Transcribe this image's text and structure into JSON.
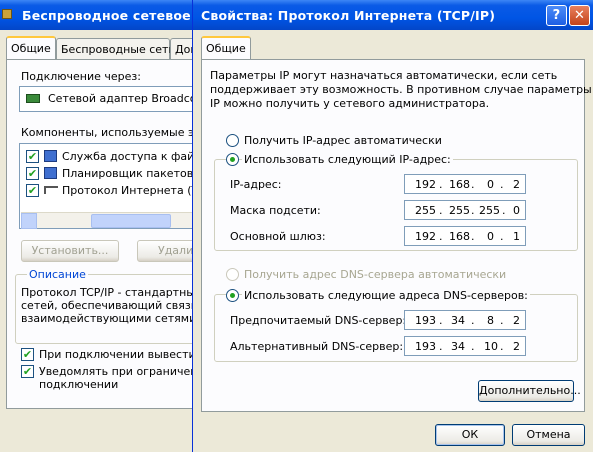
{
  "back_window": {
    "title": "Беспроводное сетевое сое",
    "tabs": [
      "Общие",
      "Беспроводные сети",
      "Доп"
    ],
    "connect_via_label": "Подключение через:",
    "adapter_name": "Сетевой адаптер Broadcom",
    "components_label": "Компоненты, используемые эти",
    "components": [
      {
        "label": "Служба доступа к файлам",
        "checked": true
      },
      {
        "label": "Планировщик пакетов Qo",
        "checked": true
      },
      {
        "label": "Протокол Интернета (TCP",
        "checked": true
      }
    ],
    "install_button": "Установить...",
    "remove_button": "Удали",
    "description_title": "Описание",
    "description_lines": [
      "Протокол TCP/IP - стандартны",
      "сетей, обеспечивающий связь",
      "взаимодействующими сетями."
    ],
    "show_icon_label": "При подключении вывести зна",
    "notify_label_1": "Уведомлять при ограниченном",
    "notify_label_2": "подключении"
  },
  "dialog": {
    "title": "Свойства: Протокол Интернета (TCP/IP)",
    "help_glyph": "?",
    "close_glyph": "✕",
    "tab": "Общие",
    "intro_lines": [
      "Параметры IP могут назначаться автоматически, если сеть",
      "поддерживает эту возможность. В противном случае параметры",
      "IP можно получить у сетевого администратора."
    ],
    "auto_ip_label": "Получить IP-адрес автоматически",
    "manual_ip_label": "Использовать следующий IP-адрес:",
    "ip_label": "IP-адрес:",
    "ip": [
      "192",
      "168",
      "0",
      "2"
    ],
    "mask_label": "Маска подсети:",
    "mask": [
      "255",
      "255",
      "255",
      "0"
    ],
    "gateway_label": "Основной шлюз:",
    "gateway": [
      "192",
      "168",
      "0",
      "1"
    ],
    "auto_dns_label": "Получить адрес DNS-сервера автоматически",
    "manual_dns_label": "Использовать следующие адреса DNS-серверов:",
    "dns1_label": "Предпочитаемый DNS-сервер:",
    "dns1": [
      "193",
      "34",
      "8",
      "2"
    ],
    "dns2_label": "Альтернативный DNS-сервер:",
    "dns2": [
      "193",
      "34",
      "10",
      "2"
    ],
    "advanced_button": "Дополнительно...",
    "ok_button": "ОК",
    "cancel_button": "Отмена"
  }
}
